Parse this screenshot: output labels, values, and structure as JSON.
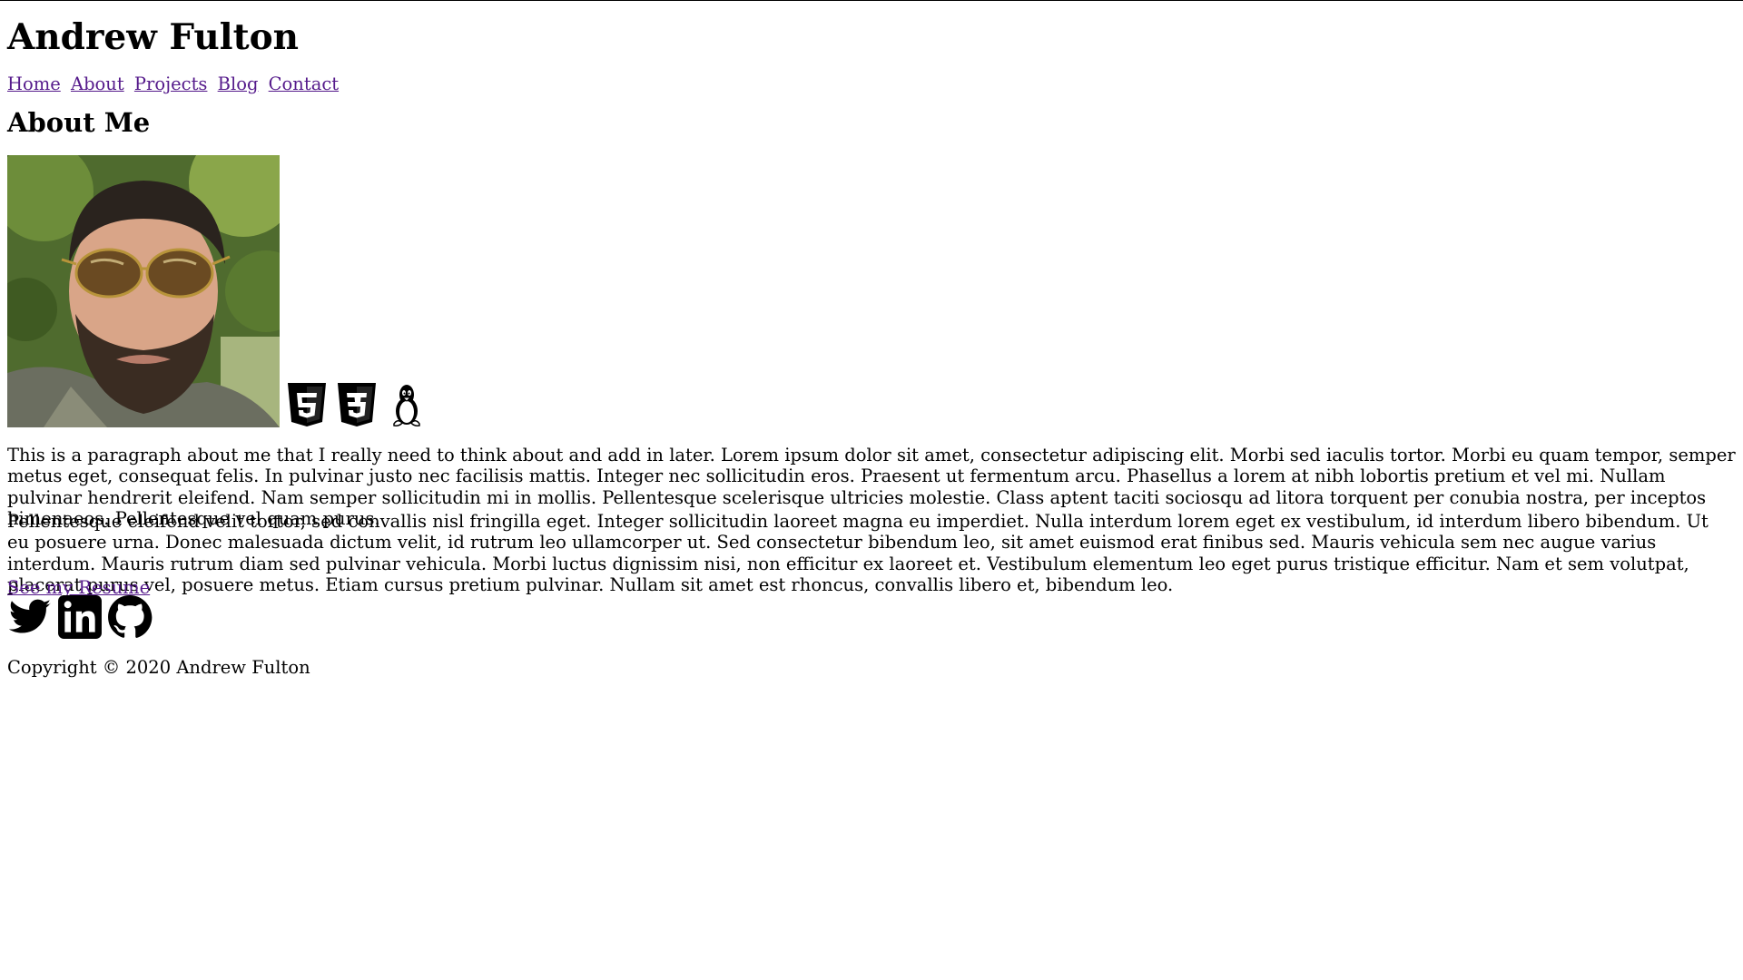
{
  "header": {
    "title": "Andrew Fulton"
  },
  "nav": {
    "items": [
      {
        "label": "Home"
      },
      {
        "label": "About"
      },
      {
        "label": "Projects"
      },
      {
        "label": "Blog"
      },
      {
        "label": "Contact"
      }
    ]
  },
  "main": {
    "heading": "About Me",
    "tech_icons": [
      "html5-icon",
      "css3-icon",
      "linux-icon"
    ],
    "paragraphs": [
      "This is a paragraph about me that I really need to think about and add in later. Lorem ipsum dolor sit amet, consectetur adipiscing elit. Morbi sed iaculis tortor. Morbi eu quam tempor, semper metus eget, consequat felis. In pulvinar justo nec facilisis mattis. Integer nec sollicitudin eros. Praesent ut fermentum arcu. Phasellus a lorem at nibh lobortis pretium et vel mi. Nullam pulvinar hendrerit eleifend. Nam semper sollicitudin mi in mollis. Pellentesque scelerisque ultricies molestie. Class aptent taciti sociosqu ad litora torquent per conubia nostra, per inceptos himenaeos. Pellentesque vel quam purus.",
      "Pellentesque eleifend velit tortor, sed convallis nisl fringilla eget. Integer sollicitudin laoreet magna eu imperdiet. Nulla interdum lorem eget ex vestibulum, id interdum libero bibendum. Ut eu posuere urna. Donec malesuada dictum velit, id rutrum leo ullamcorper ut. Sed consectetur bibendum leo, sit amet euismod erat finibus sed. Mauris vehicula sem nec augue varius interdum. Mauris rutrum diam sed pulvinar vehicula. Morbi luctus dignissim nisi, non efficitur ex laoreet et. Vestibulum elementum leo eget purus tristique efficitur. Nam et sem volutpat, placerat purus vel, posuere metus. Etiam cursus pretium pulvinar. Nullam sit amet est rhoncus, convallis libero et, bibendum leo."
    ],
    "resume_link": "See my Resume",
    "social_icons": [
      "twitter-icon",
      "linkedin-icon",
      "github-icon"
    ]
  },
  "footer": {
    "copyright": "Copyright © 2020 Andrew Fulton"
  },
  "colors": {
    "text": "#000000",
    "visited_link": "#551a8b",
    "background": "#ffffff"
  }
}
